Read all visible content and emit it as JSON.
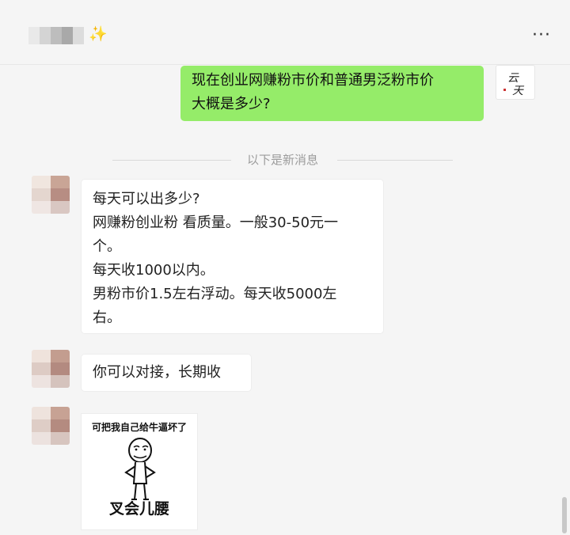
{
  "header": {
    "sparkle_icon": "✨",
    "more_label": "···"
  },
  "messages": {
    "outgoing": {
      "lines": [
        "现在创业网赚粉市价和普通男泛粉市价",
        "大概是多少?"
      ],
      "avatar_text": "云天"
    },
    "divider": "以下是新消息",
    "incoming_1": {
      "lines": [
        "每天可以出多少?",
        "网赚粉创业粉 看质量。一般30-50元一",
        "个。",
        "每天收1000以内。",
        "男粉市价1.5左右浮动。每天收5000左",
        "右。"
      ]
    },
    "incoming_2": {
      "text": "你可以对接，长期收"
    },
    "sticker": {
      "top_text": "可把我自己给牛逼坏了",
      "bottom_text": "叉会儿腰"
    }
  },
  "colors": {
    "sent_bubble": "#95ec69",
    "received_bubble": "#ffffff",
    "background": "#f5f5f5"
  }
}
